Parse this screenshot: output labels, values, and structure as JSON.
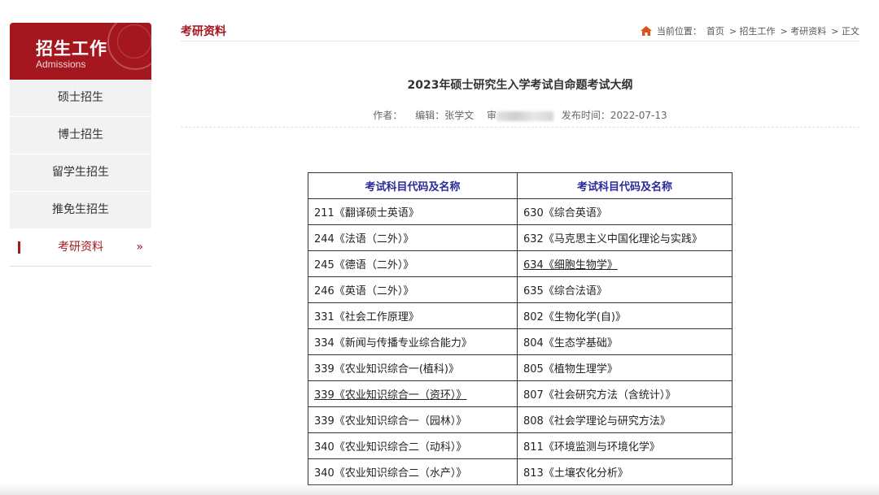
{
  "sidebar": {
    "title": "招生工作",
    "subtitle": "Admissions",
    "items": [
      {
        "label": "硕士招生"
      },
      {
        "label": "博士招生"
      },
      {
        "label": "留学生招生"
      },
      {
        "label": "推免生招生"
      },
      {
        "label": "考研资料",
        "arrow": "»"
      }
    ]
  },
  "header": {
    "section_title": "考研资料",
    "breadcrumb": [
      "当前位置：",
      "首页",
      "> 招生工作",
      "> 考研资料",
      "> 正文"
    ]
  },
  "article": {
    "title": "2023年硕士研究生入学考试自命题考试大纲",
    "author_label": "作者：",
    "editor": "编辑：张学文",
    "reviewer_prefix": "审",
    "publish": "发布时间：2022-07-13"
  },
  "table": {
    "headers": [
      "考试科目代码及名称",
      "考试科目代码及名称"
    ],
    "rows": [
      [
        "211《翻译硕士英语》",
        "630《综合英语》"
      ],
      [
        "244《法语（二外）》",
        "632《马克思主义中国化理论与实践》"
      ],
      [
        "245《德语（二外）》",
        "634《细胞生物学》"
      ],
      [
        "246《英语（二外）》",
        "635《综合法语》"
      ],
      [
        "331《社会工作原理》",
        "802《生物化学(自)》"
      ],
      [
        "334《新闻与传播专业综合能力》",
        "804《生态学基础》"
      ],
      [
        "339《农业知识综合一(植科)》",
        "805《植物生理学》"
      ],
      [
        "339《农业知识综合一（资环）》",
        "807《社会研究方法（含统计）》"
      ],
      [
        "339《农业知识综合一（园林）》",
        "808《社会学理论与研究方法》"
      ],
      [
        "340《农业知识综合二（动科）》",
        "811《环境监测与环境化学》"
      ],
      [
        "340《农业知识综合二（水产）》",
        "813《土壤农化分析》"
      ]
    ]
  },
  "colors": {
    "brand": "#a5171e",
    "header_text": "#2a2a9a"
  }
}
